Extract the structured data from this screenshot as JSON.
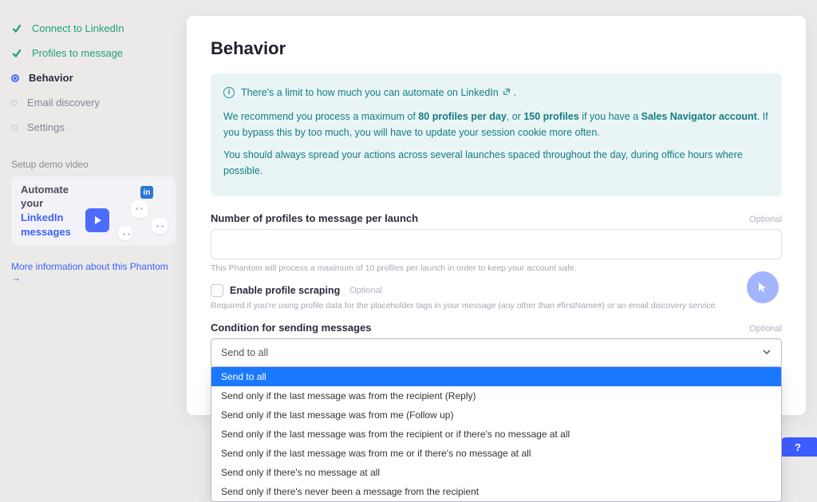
{
  "sidebar": {
    "steps": [
      {
        "label": "Connect to LinkedIn",
        "state": "done"
      },
      {
        "label": "Profiles to message",
        "state": "done"
      },
      {
        "label": "Behavior",
        "state": "active"
      },
      {
        "label": "Email discovery",
        "state": "pending"
      },
      {
        "label": "Settings",
        "state": "pending"
      }
    ],
    "demo_title": "Setup demo video",
    "demo_line1": "Automate",
    "demo_line2": "your",
    "demo_line3a": "LinkedIn",
    "demo_line3b": "messages",
    "linkedin_badge": "in",
    "more_link": "More information about this Phantom  →"
  },
  "panel": {
    "heading": "Behavior",
    "info": {
      "header": "There's a limit to how much you can automate on LinkedIn",
      "dot": ".",
      "p2_a": "We recommend you process a maximum of ",
      "p2_b": "80 profiles per day",
      "p2_c": ", or ",
      "p2_d": "150 profiles",
      "p2_e": " if you have a ",
      "p2_f": "Sales Navigator account",
      "p2_g": ". If you bypass this by too much, you will have to update your session cookie more often.",
      "p3": "You should always spread your actions across several launches spaced throughout the day, during office hours where possible."
    },
    "profiles_label": "Number of profiles to message per launch",
    "optional": "Optional",
    "profiles_value": "",
    "profiles_helper": "This Phantom will process a maximum of 10 profiles per launch in order to keep your account safe.",
    "scraping_label": "Enable profile scraping",
    "scraping_helper": "Required if you're using profile data for the placeholder tags in your message (any other than #firstName#) or an email discovery service.",
    "condition_label": "Condition for sending messages",
    "condition_selected": "Send to all",
    "condition_options": [
      "Send to all",
      "Send only if the last message was from the recipient (Reply)",
      "Send only if the last message was from me (Follow up)",
      "Send only if the last message was from the recipient or if there's no message at all",
      "Send only if the last message was from me or if there's no message at all",
      "Send only if there's no message at all",
      "Send only if there's never been a message from the recipient"
    ]
  },
  "help_label": "?"
}
